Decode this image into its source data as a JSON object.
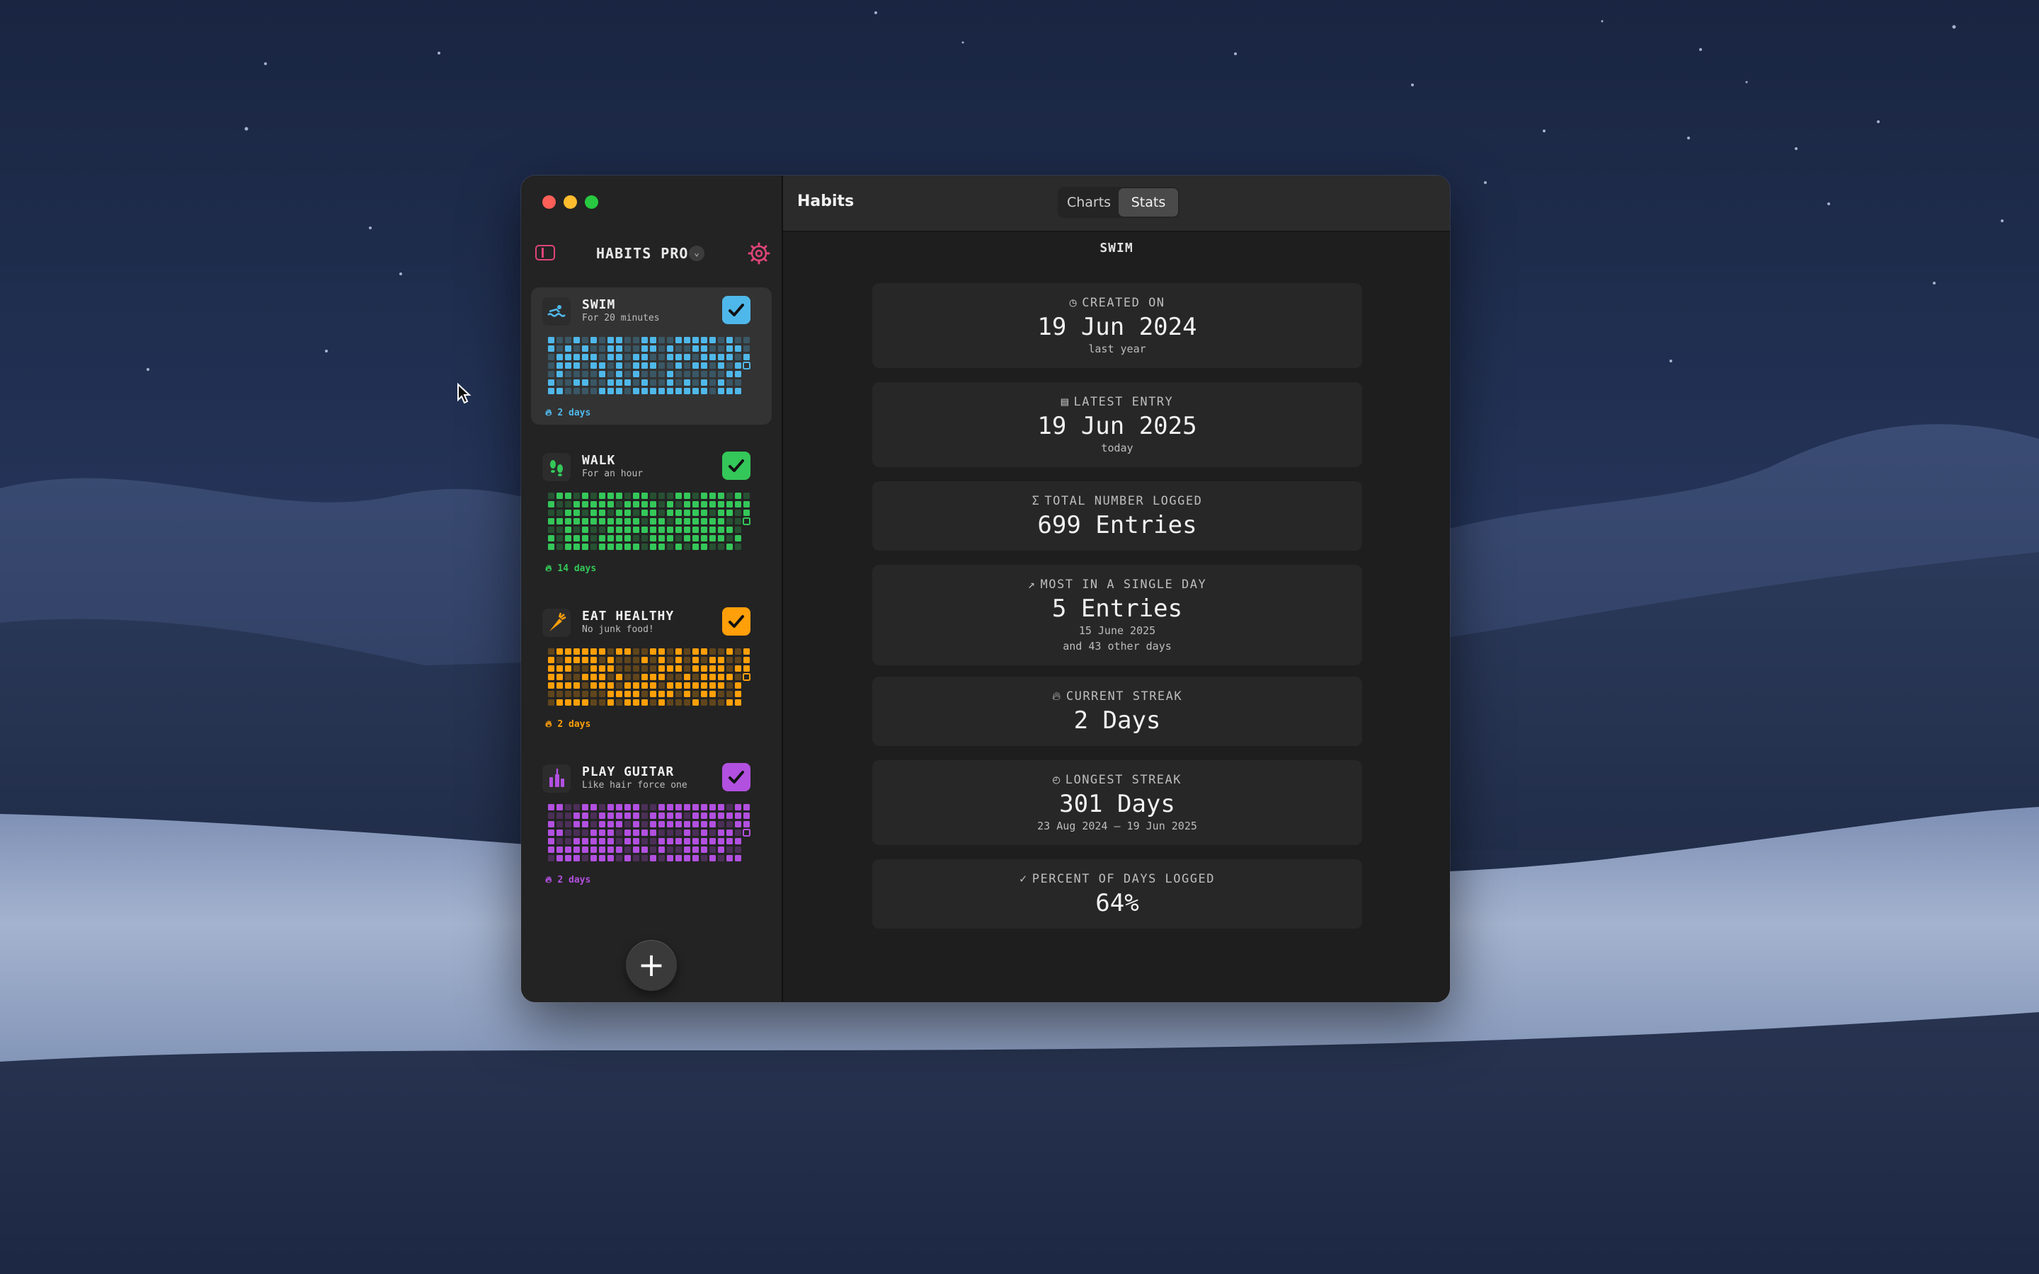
{
  "colors": {
    "swim": "#4fb8ea",
    "walk": "#34c759",
    "eat": "#ff9f0a",
    "guitar": "#b250e0",
    "accent": "#e0447a"
  },
  "sidebar": {
    "title": "HABITS PRO",
    "habits": [
      {
        "name": "SWIM",
        "subtitle": "For 20 minutes",
        "streak": "2 days",
        "icon": "swimmer-icon",
        "color": "#4fb8ea",
        "fill": 0.62,
        "checked": true
      },
      {
        "name": "WALK",
        "subtitle": "For an hour",
        "streak": "14 days",
        "icon": "footprints-icon",
        "color": "#34c759",
        "fill": 0.7,
        "checked": true
      },
      {
        "name": "EAT HEALTHY",
        "subtitle": "No junk food!",
        "streak": "2 days",
        "icon": "carrot-icon",
        "color": "#ff9f0a",
        "fill": 0.62,
        "checked": true
      },
      {
        "name": "PLAY GUITAR",
        "subtitle": "Like hair force one",
        "streak": "2 days",
        "icon": "guitar-icon",
        "color": "#b250e0",
        "fill": 0.64,
        "checked": true
      }
    ]
  },
  "toolbar": {
    "title": "Habits",
    "tabs": [
      "Charts",
      "Stats"
    ],
    "active_tab": "Stats"
  },
  "stats": {
    "habit": "SWIM",
    "items": [
      {
        "icon": "clock-icon",
        "label": "CREATED ON",
        "value": "19 Jun 2024",
        "sub": [
          "last year"
        ]
      },
      {
        "icon": "calendar-icon",
        "label": "LATEST ENTRY",
        "value": "19 Jun 2025",
        "sub": [
          "today"
        ]
      },
      {
        "icon": "sigma-icon",
        "label": "TOTAL NUMBER LOGGED",
        "value": "699 Entries",
        "sub": []
      },
      {
        "icon": "chart-icon",
        "label": "MOST IN A SINGLE DAY",
        "value": "5 Entries",
        "sub": [
          "15 June 2025",
          "and 43 other days"
        ]
      },
      {
        "icon": "flame-icon",
        "label": "CURRENT STREAK",
        "value": "2 Days",
        "sub": []
      },
      {
        "icon": "timer-icon",
        "label": "LONGEST STREAK",
        "value": "301 Days",
        "sub": [
          "23 Aug 2024 — 19 Jun 2025"
        ]
      },
      {
        "icon": "check-circle-icon",
        "label": "PERCENT OF DAYS LOGGED",
        "value": "64%",
        "sub": []
      }
    ]
  }
}
